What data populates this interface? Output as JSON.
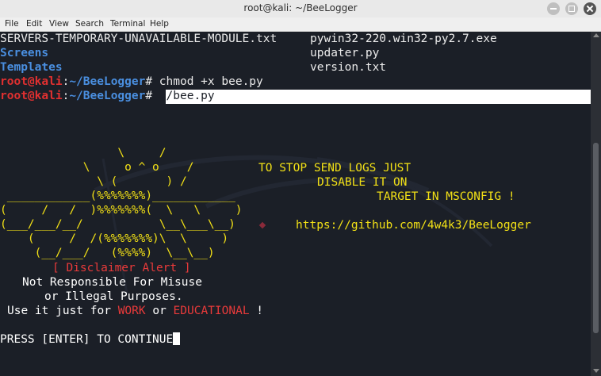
{
  "window": {
    "title": "root@kali: ~/BeeLogger"
  },
  "menu": [
    "File",
    "Edit",
    "View",
    "Search",
    "Terminal",
    "Help"
  ],
  "listing": {
    "col1": [
      "SERVERS-TEMPORARY-UNAVAILABLE-MODULE.txt",
      "Screens",
      "Templates"
    ],
    "col2": [
      "pywin32-220.win32-py2.7.exe",
      "updater.py",
      "version.txt"
    ]
  },
  "prompts": [
    {
      "user": "root@kali",
      "sep": ":",
      "path": "~/BeeLogger",
      "sym": "#",
      "cmd": " chmod +x bee.py"
    },
    {
      "user": "root@kali",
      "sep": ":",
      "path": "~/BeeLogger",
      "sym": "#",
      "cmd": " ./bee.py"
    }
  ],
  "ascii_art": [
    "                 \\     /",
    "            \\     o ^ o    /",
    "              \\ (       ) /",
    " ____________(%%%%%%%)____________",
    "(     /   /  )%%%%%%%(  \\   \\     )",
    "(___/___/__/           \\__\\___\\__)",
    "    (     /  /(%%%%%%%)\\  \\     )",
    "     (__/___/   (%%%%)  \\__\\__)"
  ],
  "notice": {
    "line1": "TO STOP SEND LOGS JUST",
    "line2": "DISABLE IT ON",
    "line3": "TARGET IN MSCONFIG !",
    "url": "https://github.com/4w4k3/BeeLogger"
  },
  "disclaimer": {
    "title": "[ Disclaimer Alert ]",
    "line1": "Not Responsible For Misuse",
    "line2": "or Illegal Purposes.",
    "line3_prefix": "Use it just for ",
    "word1": "WORK",
    "mid": " or ",
    "word2": "EDUCATIONAL",
    "suffix": " !"
  },
  "prompt_enter": "PRESS [ENTER] TO CONTINUE"
}
